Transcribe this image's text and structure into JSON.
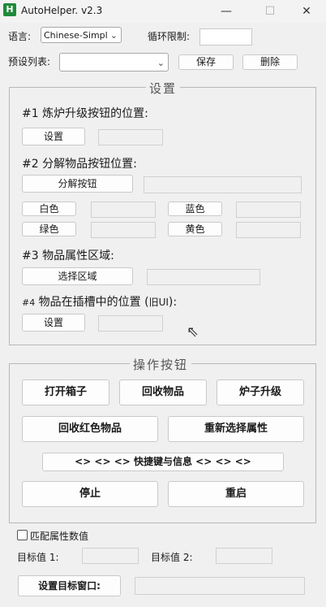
{
  "window": {
    "title": "AutoHelper. v2.3",
    "icon_letter": "H",
    "minimize": "—",
    "maximize": "☐",
    "close": "✕"
  },
  "top": {
    "language_label": "语言:",
    "language_value": "Chinese-Simpl",
    "loop_limit_label": "循环限制:",
    "loop_limit_value": "",
    "preset_label": "预设列表:",
    "preset_value": "",
    "save_label": "保存",
    "delete_label": "删除"
  },
  "settings": {
    "title": "设置",
    "s1_title": "#1 炼炉升级按钮的位置:",
    "s1_button": "设置",
    "s1_value": "",
    "s2_title": "#2 分解物品按钮位置:",
    "s2_button": "分解按钮",
    "s2_value": "",
    "colors": {
      "white": "白色",
      "blue": "蓝色",
      "green": "绿色",
      "yellow": "黄色"
    },
    "s3_title": "#3 物品属性区域:",
    "s3_button": "选择区域",
    "s3_value": "",
    "s4_title_prefix": "#4",
    "s4_title_main": " 物品在插槽中的位置 (",
    "s4_title_old": "旧UI",
    "s4_title_suffix": "):",
    "s4_button": "设置",
    "s4_value": ""
  },
  "actions": {
    "title": "操作按钮",
    "open_box": "打开箱子",
    "recycle_items": "回收物品",
    "furnace_upgrade": "炉子升级",
    "recycle_red": "回收红色物品",
    "reselect_attr": "重新选择属性",
    "shortcuts": "<> <> <> 快捷键与信息 <> <> <>",
    "stop": "停止",
    "restart": "重启"
  },
  "bottom": {
    "match_attr_label": "匹配属性数值",
    "target1_label": "目标值 1:",
    "target1_value": "",
    "target2_label": "目标值 2:",
    "target2_value": "",
    "set_target_window": "设置目标窗口:",
    "target_window_value": ""
  }
}
